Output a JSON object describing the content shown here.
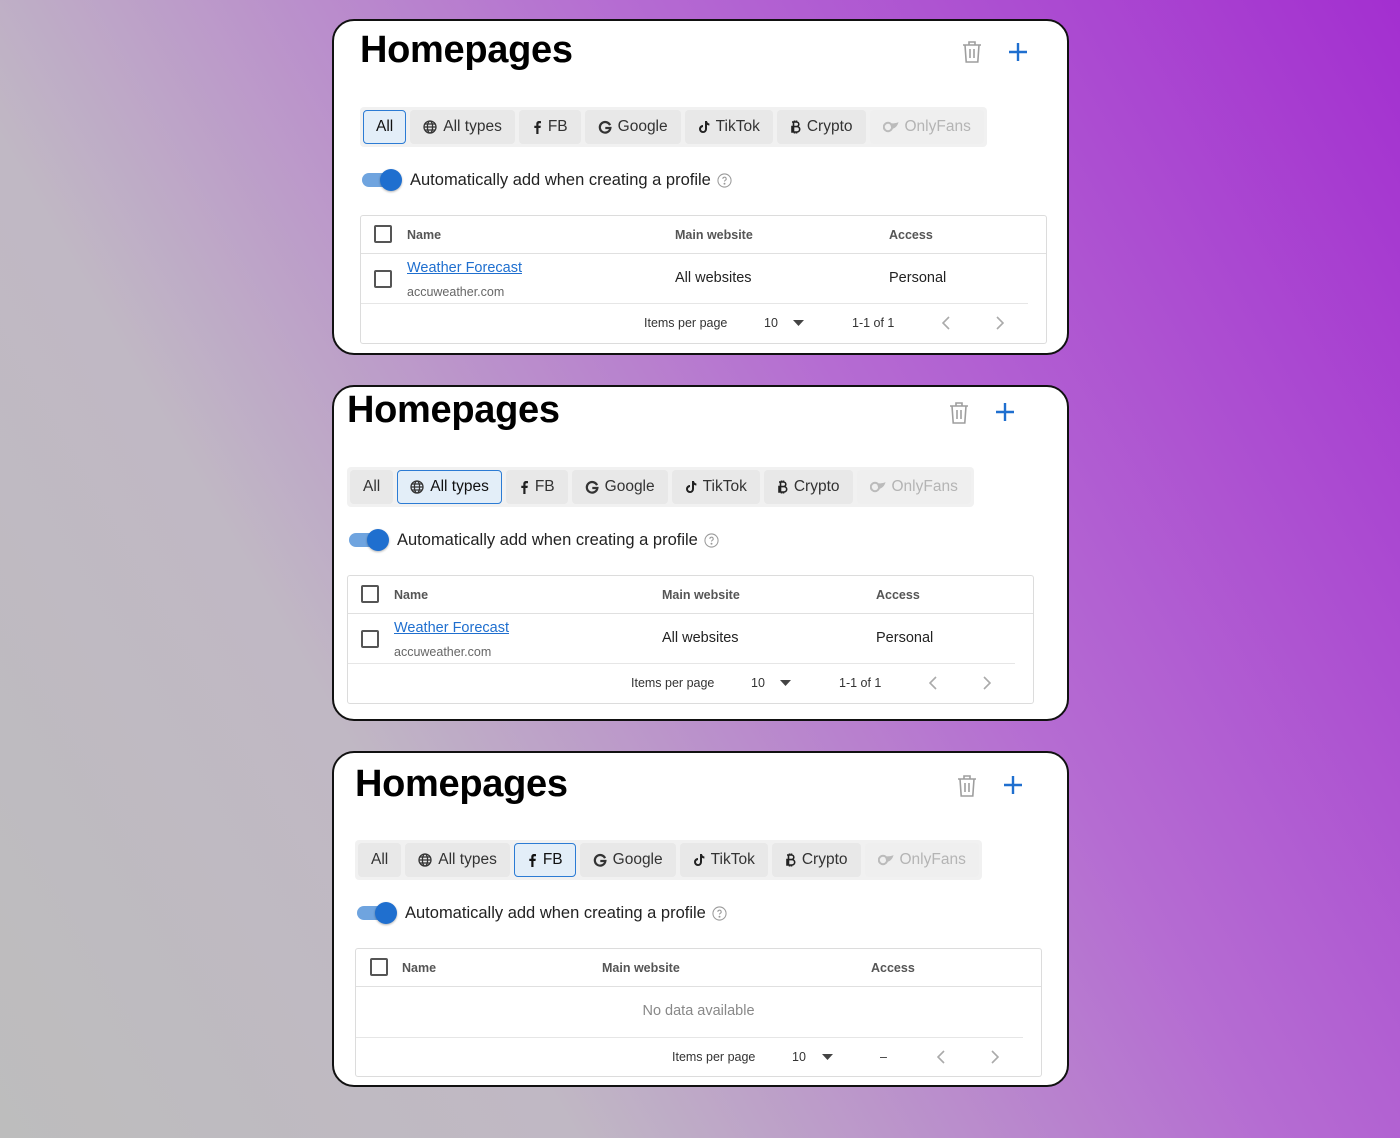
{
  "cards": [
    {
      "title": "Homepages",
      "tabs": [
        "All",
        "All types",
        "FB",
        "Google",
        "TikTok",
        "Crypto",
        "OnlyFans"
      ],
      "active_tab": "All",
      "auto_add_label": "Automatically add when creating a profile",
      "auto_add_enabled": true,
      "columns": [
        "Name",
        "Main website",
        "Access"
      ],
      "rows": [
        {
          "name": "Weather Forecast",
          "domain": "accuweather.com",
          "main_website": "All websites",
          "access": "Personal"
        }
      ],
      "items_per_page_label": "Items per page",
      "items_per_page": "10",
      "range": "1-1 of 1"
    },
    {
      "title": "Homepages",
      "tabs": [
        "All",
        "All types",
        "FB",
        "Google",
        "TikTok",
        "Crypto",
        "OnlyFans"
      ],
      "active_tab": "All types",
      "auto_add_label": "Automatically add when creating a profile",
      "auto_add_enabled": true,
      "columns": [
        "Name",
        "Main website",
        "Access"
      ],
      "rows": [
        {
          "name": "Weather Forecast",
          "domain": "accuweather.com",
          "main_website": "All websites",
          "access": "Personal"
        }
      ],
      "items_per_page_label": "Items per page",
      "items_per_page": "10",
      "range": "1-1 of 1"
    },
    {
      "title": "Homepages",
      "tabs": [
        "All",
        "All types",
        "FB",
        "Google",
        "TikTok",
        "Crypto",
        "OnlyFans"
      ],
      "active_tab": "FB",
      "auto_add_label": "Automatically add when creating a profile",
      "auto_add_enabled": true,
      "columns": [
        "Name",
        "Main website",
        "Access"
      ],
      "rows": [],
      "empty_text": "No data available",
      "items_per_page_label": "Items per page",
      "items_per_page": "10",
      "range": "–"
    }
  ],
  "colors": {
    "accent": "#1f6fcf",
    "toggle_track": "#6fa4df",
    "active_tab_bg": "#e3eef8",
    "disabled_text": "#b4b4b4"
  },
  "icons": {
    "delete": "trash-icon",
    "add": "plus-icon",
    "all_types": "globe-icon",
    "fb": "facebook-icon",
    "google": "google-icon",
    "tiktok": "tiktok-icon",
    "crypto": "bitcoin-icon",
    "onlyfans": "onlyfans-icon",
    "help": "help-icon",
    "dropdown": "caret-down-icon",
    "prev": "chevron-left-icon",
    "next": "chevron-right-icon"
  }
}
